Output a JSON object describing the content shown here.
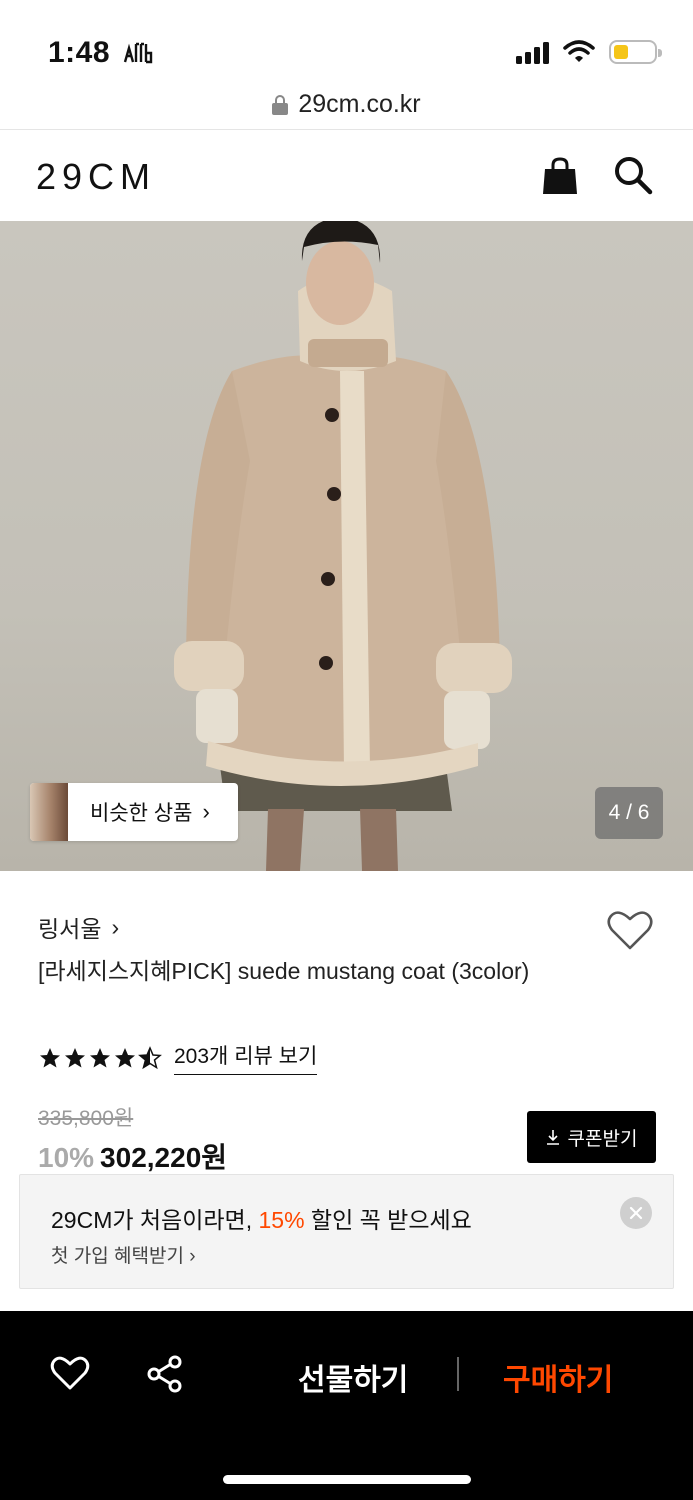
{
  "status_bar": {
    "time": "1:48",
    "extra_icon": "ℳ",
    "battery_level": 0.38,
    "battery_color": "#f5c518"
  },
  "browser": {
    "url": "29cm.co.kr",
    "lock_icon": "lock-icon"
  },
  "header": {
    "logo": "29CM",
    "cart_icon": "shopping-bag-icon",
    "search_icon": "search-icon"
  },
  "gallery": {
    "similar_label": "비슷한 상품",
    "similar_chevron": "›",
    "counter": "4 / 6"
  },
  "product": {
    "brand": "링서울",
    "brand_chevron": "›",
    "title": "[라세지스지혜PICK] suede mustang coat (3color)",
    "rating": 4.5,
    "review_link": "203개 리뷰 보기",
    "original_price": "335,800원",
    "discount": "10%",
    "final_price": "302,220원",
    "coupon_label": "쿠폰받기"
  },
  "promo": {
    "title_prefix": "29CM가 처음이라면, ",
    "title_accent": "15%",
    "title_suffix": " 할인 꼭 받으세요",
    "subtitle": "첫 가입 혜택받기 ›",
    "accent_color": "#ff4800"
  },
  "bottom_bar": {
    "gift_label": "선물하기",
    "buy_label": "구매하기",
    "buy_color": "#ff4800"
  }
}
